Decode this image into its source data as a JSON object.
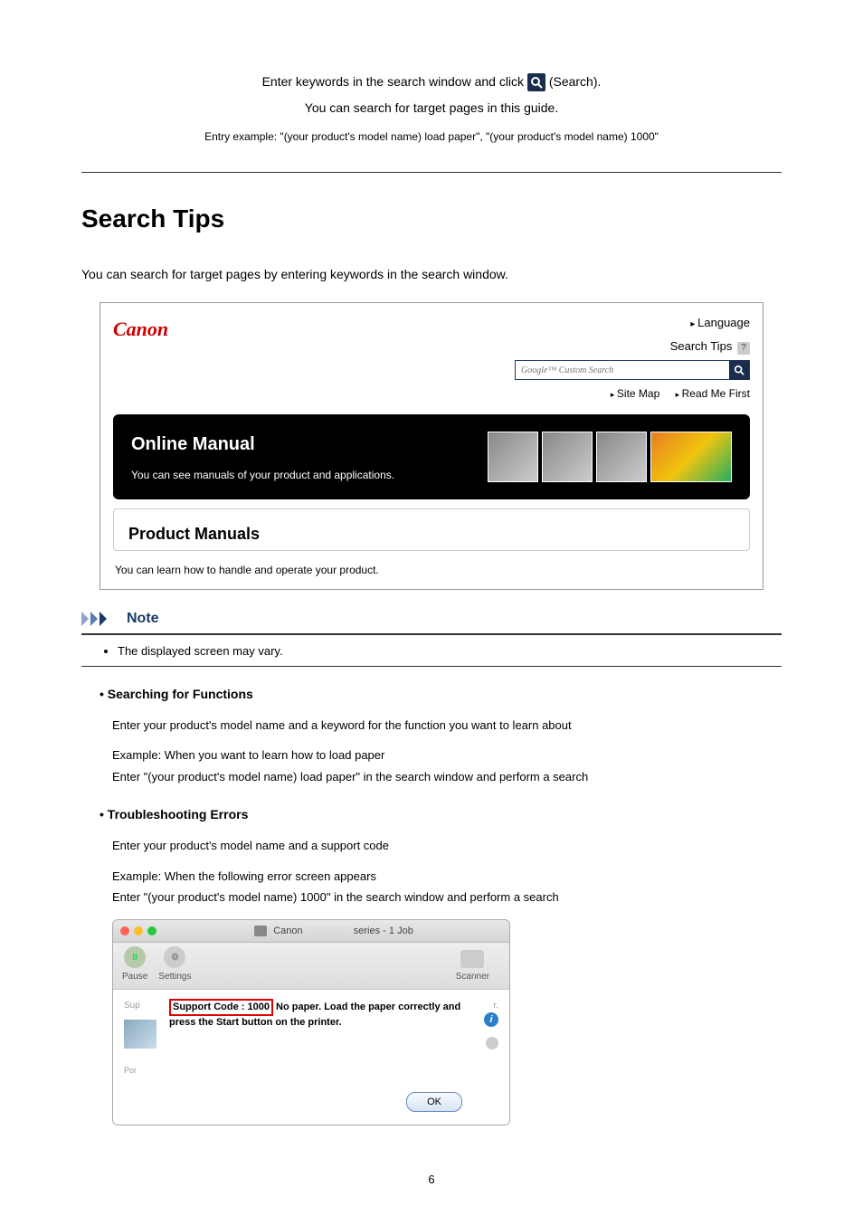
{
  "intro": {
    "line1_a": "Enter keywords in the search window and click ",
    "line1_b": " (Search).",
    "line2": "You can search for target pages in this guide.",
    "example": "Entry example: \"(your product's model name) load paper\", \"(your product's model name) 1000\""
  },
  "title": "Search Tips",
  "lead": "You can search for target pages by entering keywords in the search window.",
  "browser": {
    "logo": "Canon",
    "language": "Language",
    "search_tips": "Search Tips",
    "search_placeholder": "Google™ Custom Search",
    "sitemap": "Site Map",
    "readme": "Read Me First",
    "hero_title": "Online Manual",
    "hero_sub": "You can see manuals of your product and applications.",
    "pm_title": "Product Manuals",
    "pm_sub": "You can learn how to handle and operate your product."
  },
  "note": {
    "label": "Note",
    "item": "The displayed screen may vary."
  },
  "tips": [
    {
      "head": "Searching for Functions",
      "p1": "Enter your product's model name and a keyword for the function you want to learn about",
      "p2": "Example: When you want to learn how to load paper",
      "p3": "Enter \"(your product's model name) load paper\" in the search window and perform a search"
    },
    {
      "head": "Troubleshooting Errors",
      "p1": "Enter your product's model name and a support code",
      "p2": "Example: When the following error screen appears",
      "p3": "Enter \"(your product's model name) 1000\" in the search window and perform a search"
    }
  ],
  "error_shot": {
    "title_prefix": "Canon",
    "title_suffix": "series - 1 Job",
    "pause": "Pause",
    "settings": "Settings",
    "scanner": "Scanner",
    "sup": "Sup",
    "por": "Por",
    "support_code": "Support Code : 1000",
    "msg_rest": " No paper. Load the paper correctly and press the Start button on the printer.",
    "ok": "OK"
  },
  "page_number": "6"
}
